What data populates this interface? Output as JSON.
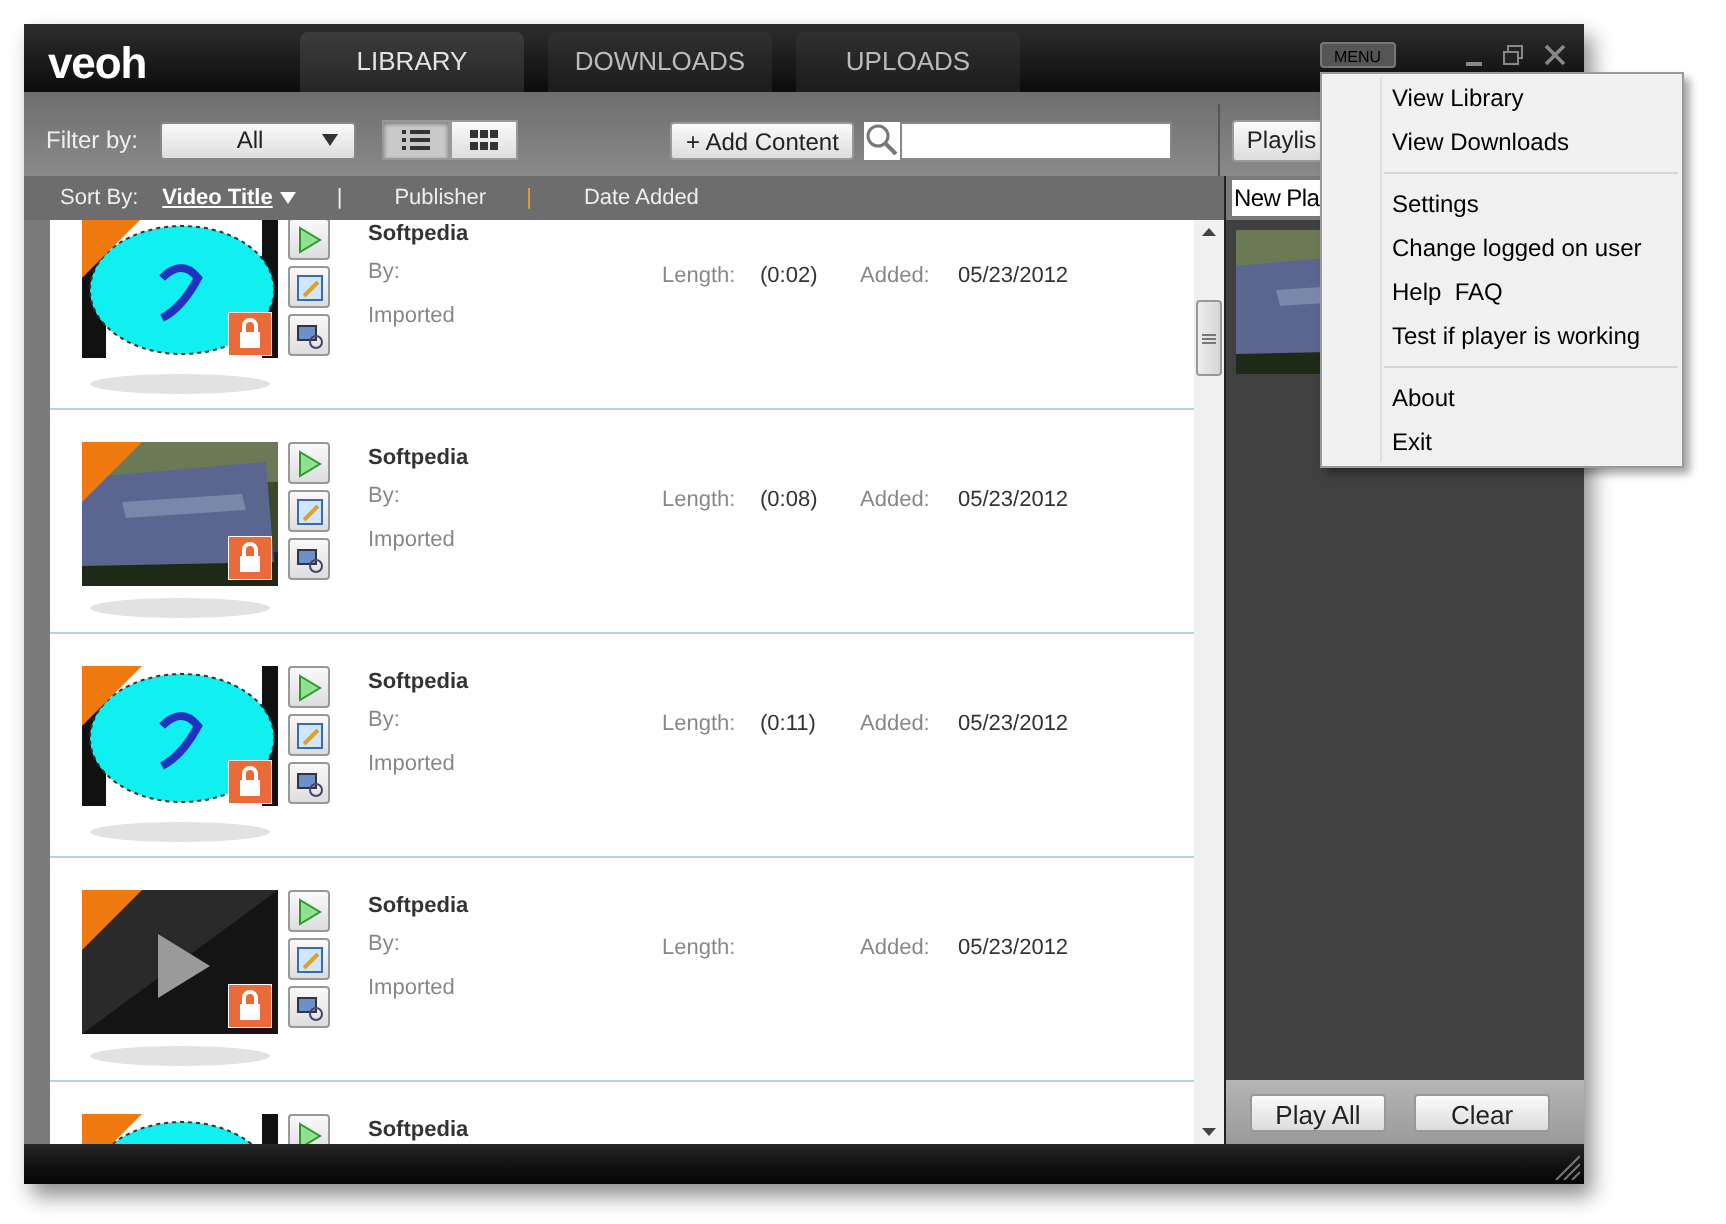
{
  "window": {
    "logo": "veoh",
    "menu_button": "MENU"
  },
  "tabs": [
    {
      "label": "LIBRARY",
      "selected": true
    },
    {
      "label": "DOWNLOADS",
      "selected": false
    },
    {
      "label": "UPLOADS",
      "selected": false
    }
  ],
  "toolbar": {
    "filter_label": "Filter by:",
    "filter_value": "All",
    "views": [
      {
        "kind": "list",
        "selected": true
      },
      {
        "kind": "grid",
        "selected": false
      }
    ],
    "add_button": "+ Add Content",
    "playlist_button": "Playlis"
  },
  "sort": {
    "label": "Sort By:",
    "separator": "|",
    "options": [
      {
        "label": "Video Title",
        "selected": true
      },
      {
        "label": "Publisher",
        "selected": false
      },
      {
        "label": "Date Added",
        "selected": false
      }
    ]
  },
  "videos": [
    {
      "title": "Softpedia",
      "by": "By:",
      "source": "Imported",
      "length_label": "Length:",
      "length": "(0:02)",
      "added_label": "Added:",
      "added": "05/23/2012"
    },
    {
      "title": "Softpedia",
      "by": "By:",
      "source": "Imported",
      "length_label": "Length:",
      "length": "(0:08)",
      "added_label": "Added:",
      "added": "05/23/2012"
    },
    {
      "title": "Softpedia",
      "by": "By:",
      "source": "Imported",
      "length_label": "Length:",
      "length": "(0:11)",
      "added_label": "Added:",
      "added": "05/23/2012"
    },
    {
      "title": "Softpedia",
      "by": "By:",
      "source": "Imported",
      "length_label": "Length:",
      "added_label": "Added:",
      "added": "05/23/2012"
    },
    {
      "title": "Softpedia"
    }
  ],
  "playlist": {
    "name": "New Pla",
    "buttons": [
      "Play All",
      "Clear"
    ]
  },
  "menu": {
    "groups": [
      [
        "View Library",
        "View Downloads"
      ],
      [
        "Settings",
        "Change logged on user",
        "Help  FAQ",
        "Test if player is working"
      ],
      [
        "About",
        "Exit"
      ]
    ]
  }
}
